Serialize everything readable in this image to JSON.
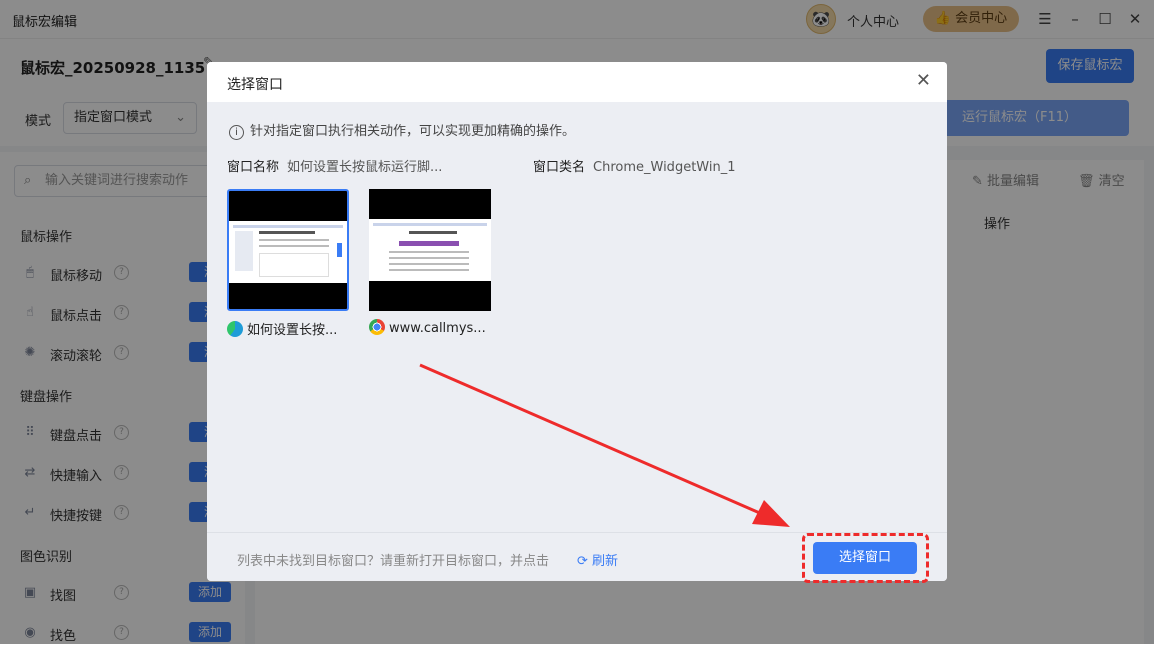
{
  "app": {
    "title": "鼠标宏编辑",
    "user_center": "个人中心",
    "vip_center": "会员中心",
    "doc_name": "鼠标宏_20250928_1135",
    "save_label": "保存鼠标宏",
    "mode_label": "模式",
    "mode_value": "指定窗口模式",
    "run_label": "运行鼠标宏（F11）",
    "search_placeholder": "输入关键词进行搜索动作",
    "bulk_edit": "批量编辑",
    "clear": "清空",
    "col_operation": "操作",
    "categories": [
      {
        "name": "鼠标操作",
        "items": [
          {
            "label": "鼠标移动",
            "add": "添"
          },
          {
            "label": "鼠标点击",
            "add": "添"
          },
          {
            "label": "滚动滚轮",
            "add": "添"
          }
        ]
      },
      {
        "name": "键盘操作",
        "items": [
          {
            "label": "键盘点击",
            "add": "添"
          },
          {
            "label": "快捷输入",
            "add": "添"
          },
          {
            "label": "快捷按键",
            "add": "添"
          }
        ]
      },
      {
        "name": "图色识别",
        "items": [
          {
            "label": "找图",
            "add": "添加"
          },
          {
            "label": "找色",
            "add": "添加"
          }
        ]
      }
    ]
  },
  "dialog": {
    "title": "选择窗口",
    "hint": "针对指定窗口执行相关动作，可以实现更加精确的操作。",
    "window_name_key": "窗口名称",
    "window_name_value": "如何设置长按鼠标运行脚...",
    "window_class_key": "窗口类名",
    "window_class_value": "Chrome_WidgetWin_1",
    "windows": [
      {
        "label": "如何设置长按...",
        "browser_icon": "edge-icon",
        "selected": true
      },
      {
        "label": "www.callmys...",
        "browser_icon": "chrome-icon",
        "selected": false
      }
    ],
    "footer_text": "列表中未找到目标窗口？请重新打开目标窗口，并点击",
    "refresh_label": "刷新",
    "choose_label": "选择窗口"
  },
  "colors": {
    "primary": "#3a7cf5",
    "annotation": "#ee2b2b",
    "vip_gold": "#e8c088"
  }
}
